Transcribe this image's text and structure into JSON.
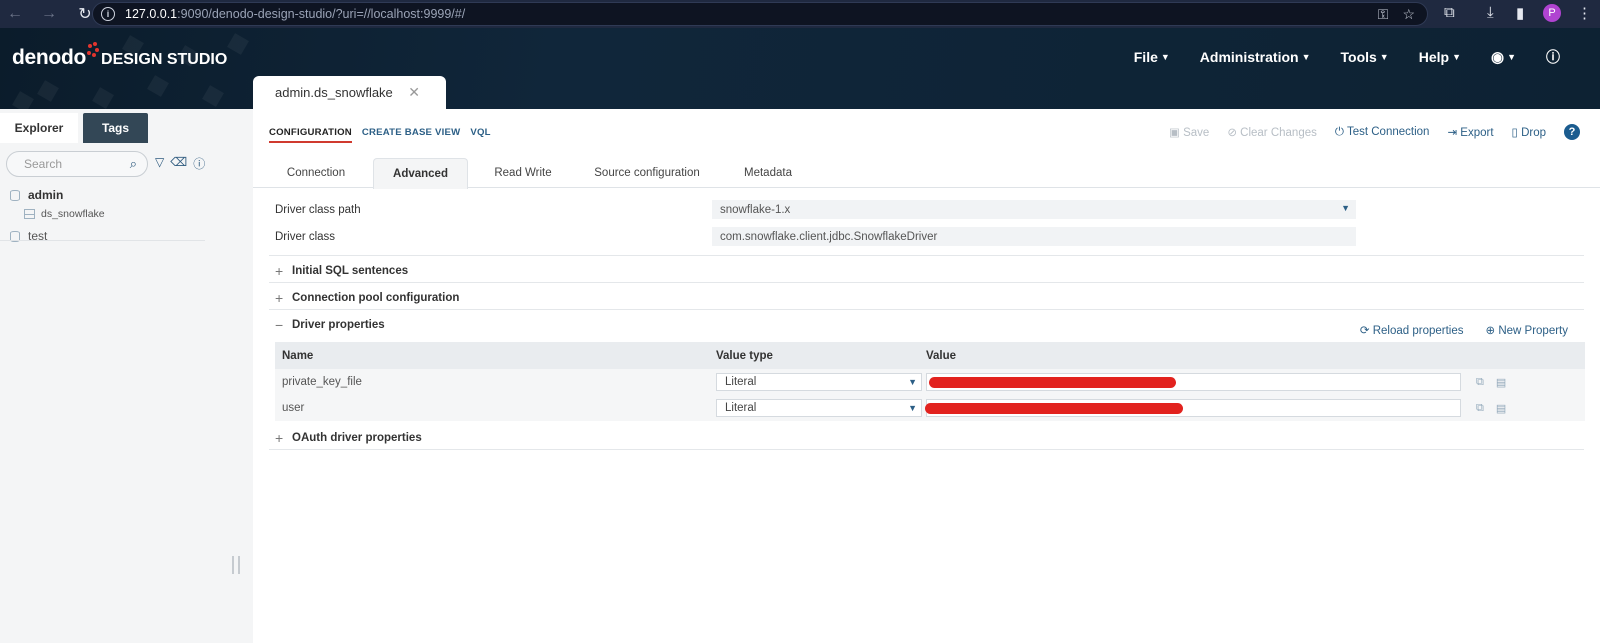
{
  "browser": {
    "url_host": "127.0.0.1",
    "url_path": ":9090/denodo-design-studio/?uri=//localhost:9999/#/",
    "profile_initial": "P"
  },
  "app": {
    "logo_text": "denodo",
    "logo_sub": "DESIGN STUDIO",
    "menu": [
      {
        "label": "File"
      },
      {
        "label": "Administration"
      },
      {
        "label": "Tools"
      },
      {
        "label": "Help"
      }
    ],
    "doc_tab_label": "admin.ds_snowflake"
  },
  "sidebar": {
    "tabs": [
      "Explorer",
      "Tags"
    ],
    "search_placeholder": "Search",
    "tree": {
      "admin": "admin",
      "ds_snowflake": "ds_snowflake",
      "test": "test"
    }
  },
  "main": {
    "subnav": [
      "CONFIGURATION",
      "CREATE BASE VIEW",
      "VQL"
    ],
    "actions": {
      "save": "Save",
      "clear": "Clear Changes",
      "test": "Test Connection",
      "export": "Export",
      "drop": "Drop"
    },
    "tabs": [
      "Connection",
      "Advanced",
      "Read Write",
      "Source configuration",
      "Metadata"
    ],
    "fields": {
      "driver_class_path_label": "Driver class path",
      "driver_class_path_value": "snowflake-1.x",
      "driver_class_label": "Driver class",
      "driver_class_value": "com.snowflake.client.jdbc.SnowflakeDriver"
    },
    "sections": {
      "initial_sql": "Initial SQL sentences",
      "pool": "Connection pool configuration",
      "driver_props": "Driver properties",
      "oauth": "OAuth driver properties"
    },
    "driver_actions": {
      "reload": "Reload properties",
      "new": "New Property"
    },
    "table": {
      "headers": [
        "Name",
        "Value type",
        "Value"
      ],
      "rows": [
        {
          "name": "private_key_file",
          "type": "Literal"
        },
        {
          "name": "user",
          "type": "Literal"
        }
      ]
    }
  },
  "colors": {
    "accent": "#2c5f86",
    "header_bg": "#0b1c2b",
    "active_underline": "#d03a2f",
    "redaction": "#e2221e"
  }
}
